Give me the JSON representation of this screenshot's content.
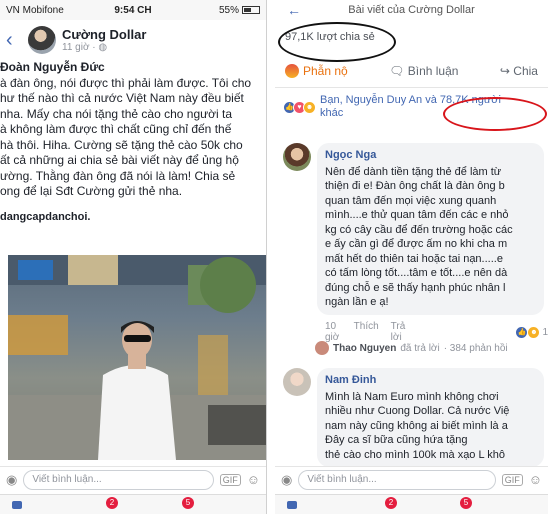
{
  "left": {
    "status": {
      "carrier": "VN Mobifone",
      "time": "9:54 CH",
      "battery": "55%"
    },
    "header": {
      "name": "Cường Dollar",
      "time": "11 giờ"
    },
    "post": {
      "author": "Đoàn Nguyễn Đức",
      "lines": [
        "à đàn ông, nói được thì phải làm được. Tôi cho",
        "hư thế nào thì cả nước Việt Nam này đều biết",
        "nha. Mấy cha nói tặng thẻ cào cho người ta",
        "à không làm được thì chất cũng chỉ đến thế",
        "hà thôi. Hiha. Cường sẽ tặng thẻ cào 50k cho",
        "ất cả những ai chia sẻ bài viết này để ủng hộ",
        "ường. Thằng đàn ông đã nói là làm! Chia sẻ",
        "ong để lại Sđt Cường gửi thẻ nha."
      ],
      "hashtag": "dangcapdanchoi."
    },
    "comment_placeholder": "Viết bình luận...",
    "tabbar": {
      "badge1": "2",
      "badge2": "5"
    }
  },
  "right": {
    "title": "Bài viết của Cường Dollar",
    "shares": "97,1K lượt chia sẻ",
    "actions": {
      "angry": "Phẫn nộ",
      "comment": "Bình luận",
      "share": "Chia"
    },
    "reactors": {
      "line1a": "Bạn, Nguyễn Duy An",
      "line1b": "và 78,7K người",
      "line2": "khác"
    },
    "comments": [
      {
        "name": "Ngọc Nga",
        "lines": [
          "Nên để dành tiền tặng thẻ để làm từ",
          "thiện đi e! Đàn ông chất là đàn ông b",
          "quan tâm đến mọi việc xung quanh",
          "mình....e thử quan tâm đến các e nhỏ",
          "kg có cây cầu để đến trường hoặc các",
          "e ấy cần gì để được ấm no khi cha m",
          "mất hết do thiên tai hoặc tai nạn.....e",
          "có tấm lòng tốt....tâm e tốt....e nên dà",
          "đúng chỗ e sẽ thấy hạnh phúc nhân l",
          "ngàn lần e ạ!"
        ],
        "meta": {
          "time": "10 giờ",
          "like": "Thích",
          "reply": "Trả lời",
          "count": "1"
        }
      },
      {
        "name": "Nam Đinh",
        "lines": [
          "Mình là Nam Euro mình không chơi",
          "nhiều như Cuong Dollar. Cả nước Việ",
          "nam này cũng không ai biết mình là a",
          "Đây ca sĩ  bữa cũng hứa tặng",
          "thẻ cào cho mình 100k mà xạo L khô"
        ]
      }
    ],
    "reply": {
      "who": "Thao Nguyen",
      "did": "đã trả lời",
      "count": "· 384 phản hồi"
    },
    "comment_placeholder": "Viết bình luận...",
    "tabbar": {
      "badge1": "2",
      "badge2": "5"
    }
  }
}
